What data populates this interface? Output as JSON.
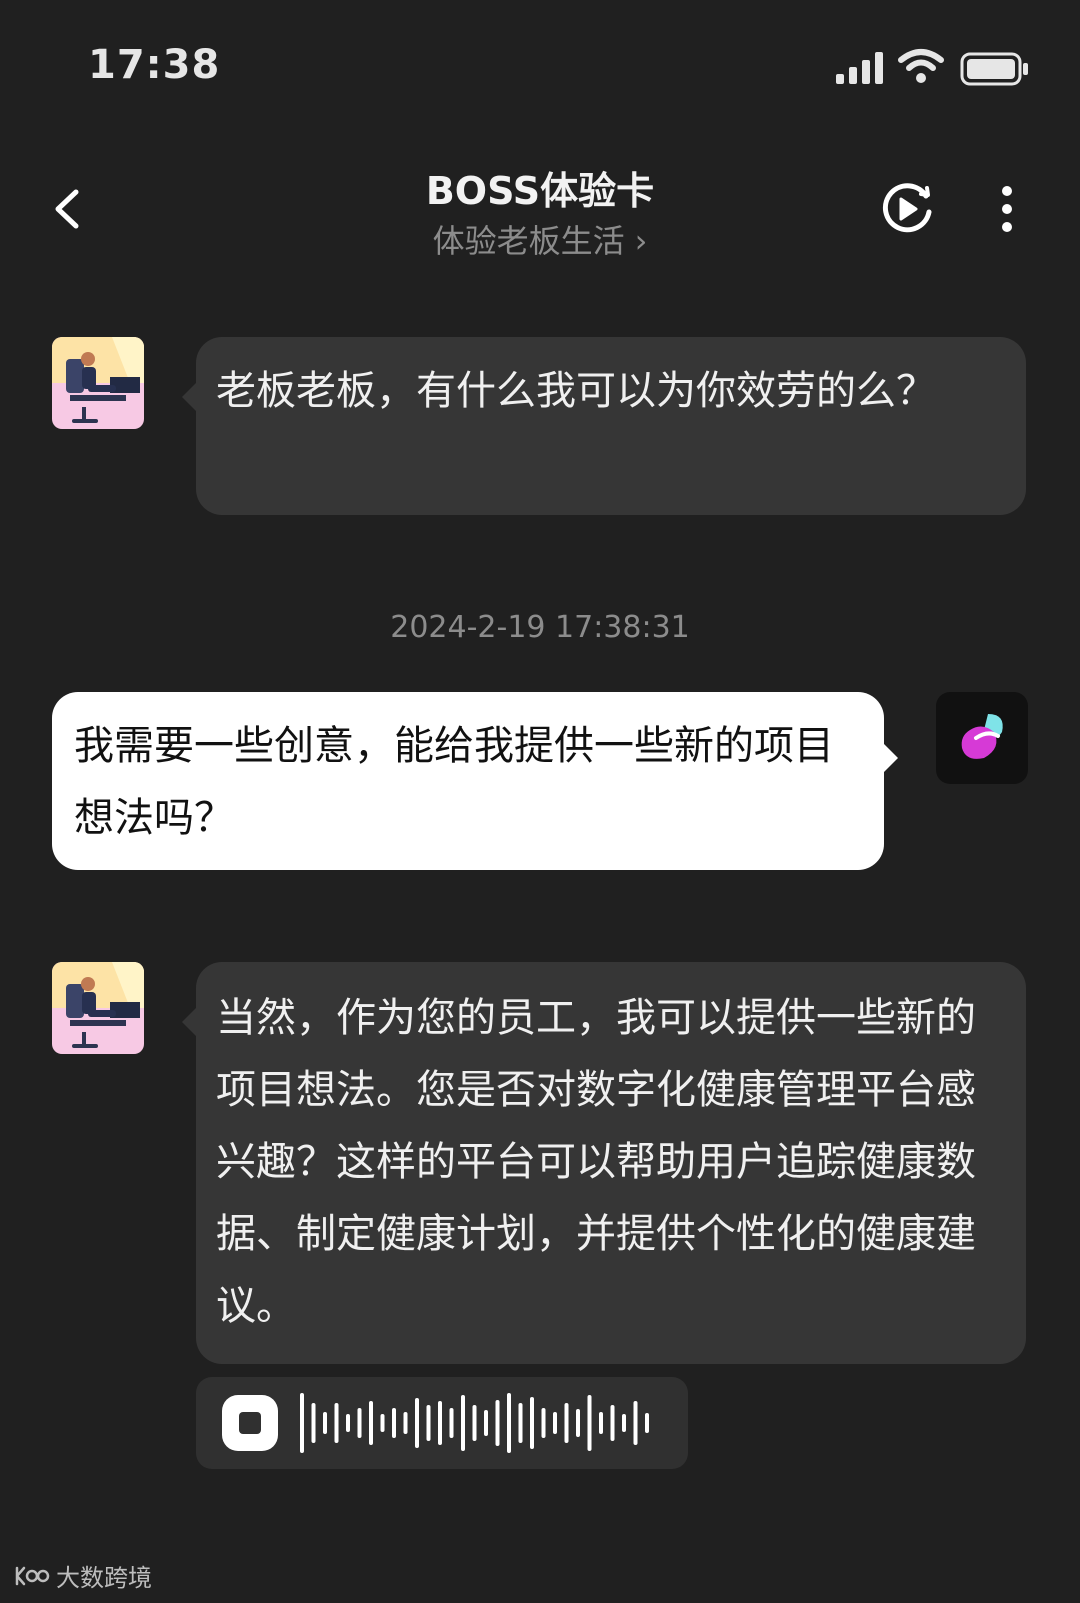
{
  "status_bar": {
    "time": "17:38"
  },
  "header": {
    "title": "BOSS体验卡",
    "subtitle": "体验老板生活",
    "subtitle_chevron": "›"
  },
  "icons": {
    "back": "chevron-left-icon",
    "play": "play-circle-icon",
    "more": "more-vertical-icon",
    "stop": "stop-icon"
  },
  "messages": [
    {
      "sender": "bot",
      "text": "老板老板，有什么我可以为你效劳的么？"
    },
    {
      "sender": "user",
      "text": "我需要一些创意，能给我提供一些新的项目想法吗？"
    },
    {
      "sender": "bot",
      "text": "当然，作为您的员工，我可以提供一些新的项目想法。您是否对数字化健康管理平台感兴趣？这样的平台可以帮助用户追踪健康数据、制定健康计划，并提供个性化的健康建议。"
    }
  ],
  "timestamp": "2024-2-19 17:38:31",
  "watermark": "大数跨境",
  "colors": {
    "background": "#202020",
    "bot_bubble": "#363636",
    "user_bubble": "#ffffff",
    "accent_magenta": "#d63ad6",
    "accent_cyan": "#7fe3e8"
  }
}
